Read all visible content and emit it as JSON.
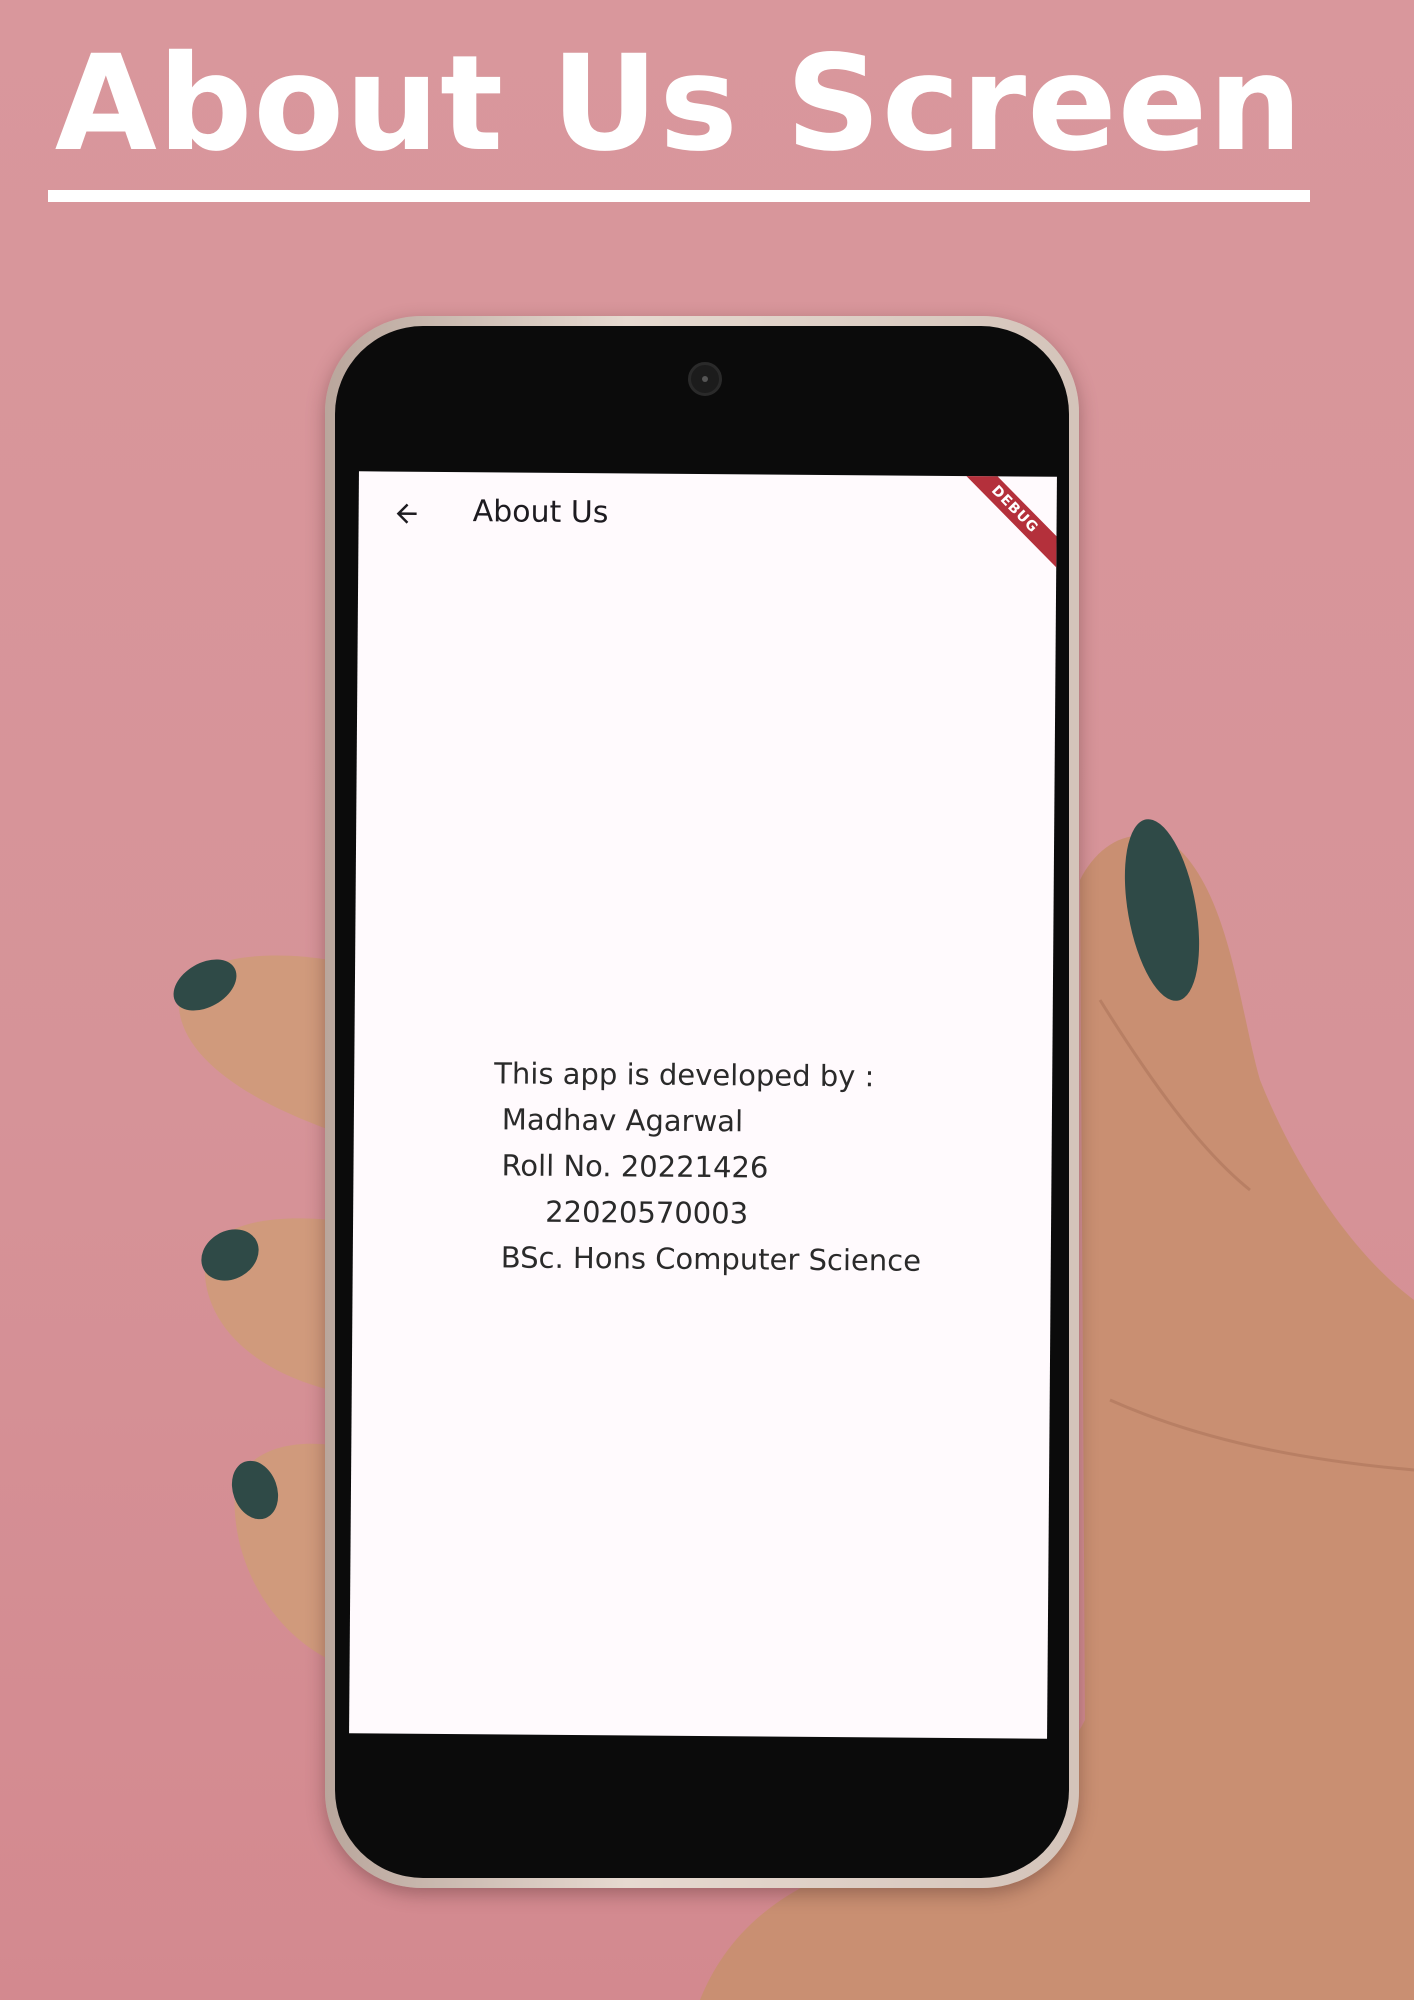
{
  "poster": {
    "title": "About Us Screen"
  },
  "app_bar": {
    "back_icon": "arrow-left-icon",
    "title": "About Us",
    "debug_banner": "DEBUG"
  },
  "body": {
    "line1": "This app is developed by :",
    "line2": "Madhav Agarwal",
    "line3": "Roll No. 20221426",
    "line4": "22020570003",
    "line5": "BSc. Hons Computer Science"
  },
  "colors": {
    "background": "#d9979c",
    "screen": "#fffafd",
    "debug_banner": "#b4303b",
    "text": "#2a2a2a"
  }
}
